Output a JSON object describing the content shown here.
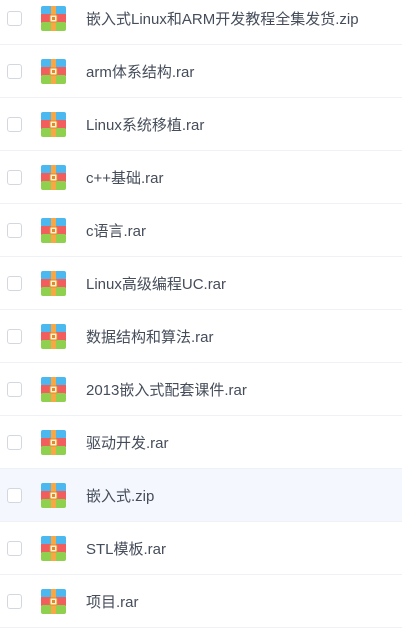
{
  "files": [
    {
      "name": "嵌入式Linux和ARM开发教程全集发货.zip",
      "icon": "archive-icon",
      "hovered": false
    },
    {
      "name": "arm体系结构.rar",
      "icon": "archive-icon",
      "hovered": false
    },
    {
      "name": "Linux系统移植.rar",
      "icon": "archive-icon",
      "hovered": false
    },
    {
      "name": "c++基础.rar",
      "icon": "archive-icon",
      "hovered": false
    },
    {
      "name": "c语言.rar",
      "icon": "archive-icon",
      "hovered": false
    },
    {
      "name": "Linux高级编程UC.rar",
      "icon": "archive-icon",
      "hovered": false
    },
    {
      "name": "数据结构和算法.rar",
      "icon": "archive-icon",
      "hovered": false
    },
    {
      "name": "2013嵌入式配套课件.rar",
      "icon": "archive-icon",
      "hovered": false
    },
    {
      "name": "驱动开发.rar",
      "icon": "archive-icon",
      "hovered": false
    },
    {
      "name": "嵌入式.zip",
      "icon": "archive-icon",
      "hovered": true
    },
    {
      "name": "STL模板.rar",
      "icon": "archive-icon",
      "hovered": false
    },
    {
      "name": "项目.rar",
      "icon": "archive-icon",
      "hovered": false
    }
  ],
  "colors": {
    "icon_top": "#4cb8f0",
    "icon_middle": "#f25e5e",
    "icon_bottom": "#8fd14f",
    "icon_stripe": "#f7a844",
    "text": "#454d5a"
  }
}
